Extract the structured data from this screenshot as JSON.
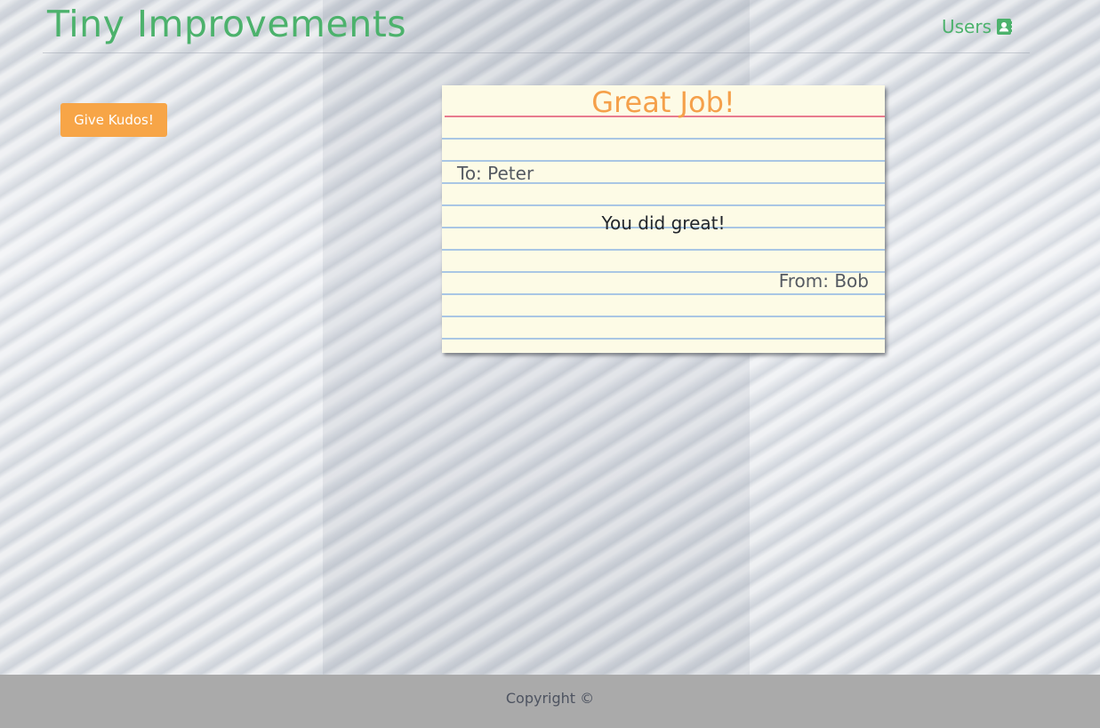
{
  "header": {
    "brand": "Tiny Improvements",
    "users_label": "Users",
    "users_icon": "address-card-icon"
  },
  "actions": {
    "give_kudos_label": "Give Kudos!"
  },
  "kudos_card": {
    "title": "Great Job!",
    "to": "To: Peter",
    "message": "You did great!",
    "from": "From: Bob"
  },
  "footer": {
    "copyright": "Copyright ©"
  },
  "colors": {
    "brand_green": "#4cb26c",
    "button_orange": "#f7a547",
    "card_title_orange": "#f5a04a",
    "footer_gray": "#aaaaaa"
  }
}
